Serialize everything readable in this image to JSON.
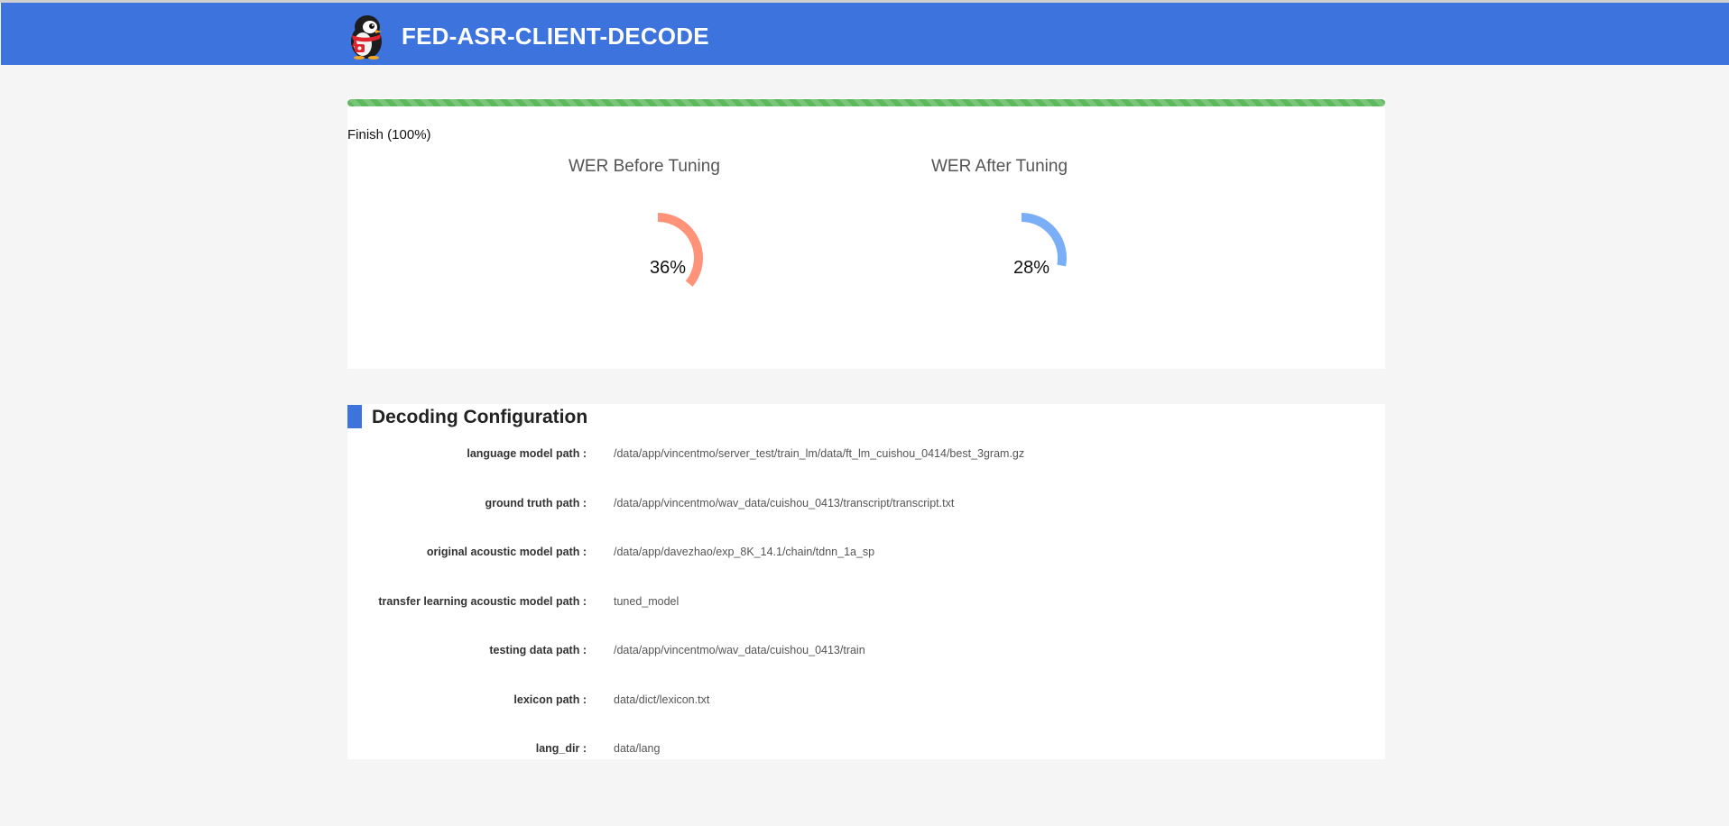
{
  "header": {
    "title": "FED-ASR-CLIENT-DECODE",
    "logo_icon": "penguin-logo-icon",
    "background_color": "#3c73dc"
  },
  "progress": {
    "label": "Finish (100%)",
    "percent": 100,
    "color": "#5cb85c"
  },
  "gauges": [
    {
      "title": "WER Before Tuning",
      "value_text": "36%",
      "value": 36,
      "color": "#ff937a"
    },
    {
      "title": "WER After Tuning",
      "value_text": "28%",
      "value": 28,
      "color": "#7aaef7"
    }
  ],
  "config": {
    "title": "Decoding Configuration",
    "rows": [
      {
        "label": "language model path :",
        "value": "/data/app/vincentmo/server_test/train_lm/data/ft_lm_cuishou_0414/best_3gram.gz"
      },
      {
        "label": "ground truth path :",
        "value": "/data/app/vincentmo/wav_data/cuishou_0413/transcript/transcript.txt"
      },
      {
        "label": "original acoustic model path :",
        "value": "/data/app/davezhao/exp_8K_14.1/chain/tdnn_1a_sp"
      },
      {
        "label": "transfer learning acoustic model path :",
        "value": "tuned_model"
      },
      {
        "label": "testing data path :",
        "value": "/data/app/vincentmo/wav_data/cuishou_0413/train"
      },
      {
        "label": "lexicon path :",
        "value": "data/dict/lexicon.txt"
      },
      {
        "label": "lang_dir :",
        "value": "data/lang"
      }
    ]
  }
}
